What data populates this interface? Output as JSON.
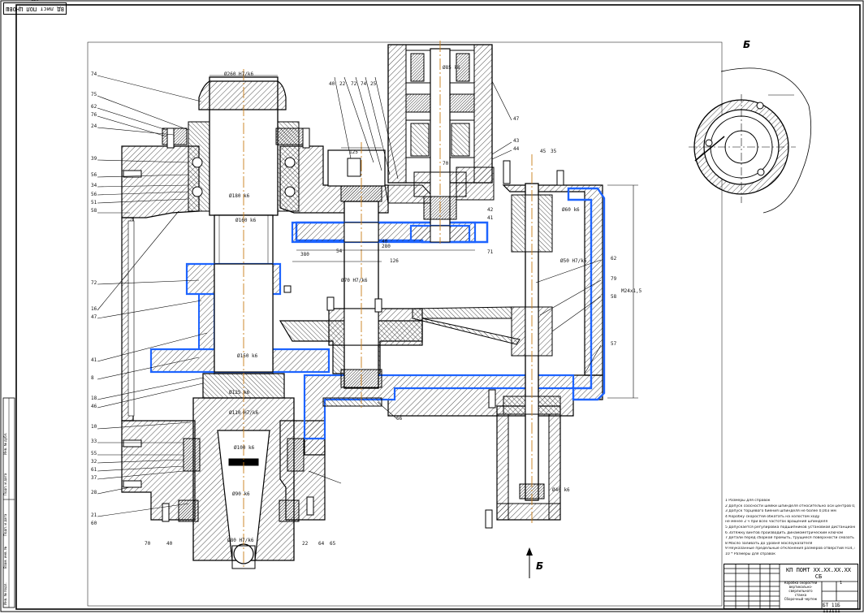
{
  "sheet": {
    "corner_stamp": "ВД лист ПОЛ ЦНОВШ ЦМ",
    "section_view_label": "Б",
    "section_arrow_label": "Б"
  },
  "colors": {
    "line": "#000000",
    "highlight": "#1e64ff",
    "axis": "#c87c18",
    "hatch": "#222222"
  },
  "callouts_left": [
    "74",
    "75",
    "62",
    "76",
    "24",
    "39",
    "56",
    "34",
    "56",
    "51",
    "58",
    "72",
    "16",
    "47",
    "41",
    "8",
    "18",
    "46",
    "10",
    "33",
    "55",
    "32",
    "61",
    "37",
    "28",
    "21",
    "60"
  ],
  "callouts_top": [
    "40",
    "22",
    "72",
    "74",
    "25"
  ],
  "callouts_right": [
    "47",
    "43",
    "44",
    "45",
    "35",
    "42",
    "41",
    "71",
    "62",
    "79",
    "58",
    "57"
  ],
  "callouts_bottom": [
    "70",
    "40",
    "22",
    "64",
    "65",
    "66"
  ],
  "dimensions": [
    "Ø260 H7/k6",
    "Ø180 k6",
    "Ø160 k6",
    "Ø150 k6",
    "Ø125 k6",
    "Ø110 H7/k6",
    "Ø100 k6",
    "Ø90 k6",
    "Ø85 k6",
    "Ø80 H7/k6",
    "Ø70 H7/k6",
    "Ø60 k6",
    "Ø50 H7/k6",
    "Ø40 k6",
    "М24х1,5",
    "380",
    "280",
    "126",
    "125",
    "70",
    "54",
    "40"
  ],
  "notes": [
    "1 Размеры для справок",
    "2 Допуск соосности шейки шпинделя относительно оси центров 0,005 мм",
    "3 Допуск торцевого биения шпинделя не более 0,003 мм",
    "4 Коробку скоростей обкатать на холостом ходу",
    "не менее 2 ч при всех частотах вращения шпинделя",
    "5 Допускается регулировка подшипников установкой дистанционных колец",
    "6 Затяжку винтов производить динамометрическим ключом",
    "7 Детали перед сборкой промыть, трущиеся поверхности смазать",
    "8 Масло заливать до уровня маслоуказателя",
    "9 Неуказанные предельные отклонения размеров отверстий Н14, валов h14",
    "10 * Размеры для справок"
  ],
  "title_block": {
    "code": "КП ПОМТ ХХ.ХХ.ХХ.ХХ СБ",
    "name_line1": "Коробка скоростей",
    "name_line2": "вертикально-сверлильного",
    "name_line3": "станка",
    "name_line4": "Сборочный чертеж",
    "sheet_no": "1",
    "group": "БТ 11Б 111111"
  },
  "binding_strip": [
    "Подп. и дата",
    "Инв. № дубл.",
    "Взам. инв. №",
    "Подп. и дата",
    "Инв. № подл."
  ]
}
